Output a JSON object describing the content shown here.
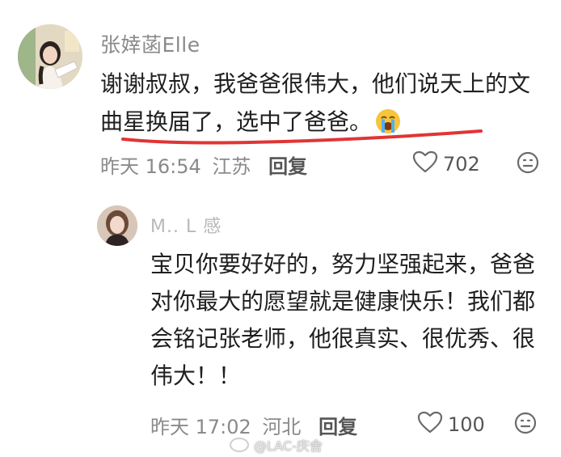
{
  "main_comment": {
    "username": "张婞菡Elle",
    "text": "谢谢叔叔，我爸爸很伟大，他们说天上的文曲星换届了，选中了爸爸。",
    "emoji": "loudly-crying-face",
    "time": "昨天 16:54",
    "location": "江苏",
    "reply_label": "回复",
    "likes": "702",
    "avatar_icon": "avatar-girl-icon",
    "underline_color": "#e03535"
  },
  "reply_comment": {
    "username": "M.. L 感",
    "text": "宝贝你要好好的，努力坚强起来，爸爸对你最大的愿望就是健康快乐！我们都会铭记张老师，他很真实、很优秀、很伟大！！",
    "time": "昨天 17:02",
    "location": "河北",
    "reply_label": "回复",
    "likes": "100",
    "avatar_icon": "avatar-woman-icon"
  },
  "watermark": {
    "text": "@LAC-庆舍",
    "icon": "weibo-logo-icon"
  },
  "colors": {
    "meta_gray": "#8a8a8a",
    "text": "#1f1f1f",
    "accent_red": "#e03535"
  }
}
